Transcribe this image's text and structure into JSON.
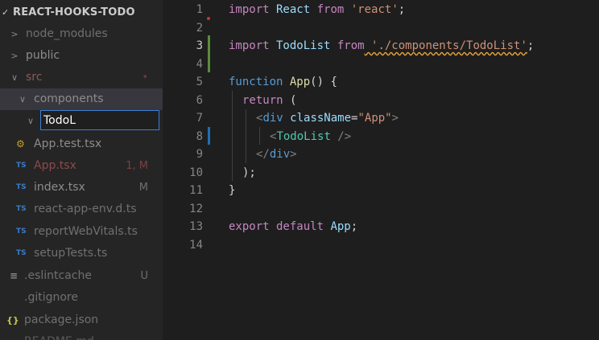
{
  "sidebar": {
    "header": "REACT-HOOKS-TODO",
    "items": [
      {
        "label": "node_modules",
        "status": ""
      },
      {
        "label": "public",
        "status": ""
      },
      {
        "label": "src",
        "status": "•"
      },
      {
        "label": "components",
        "status": ""
      },
      {
        "label": "TodoL",
        "status": ""
      },
      {
        "label": "App.test.tsx",
        "icon": "test-flask-icon",
        "status": ""
      },
      {
        "label": "App.tsx",
        "icon": "TS",
        "status": "1, M"
      },
      {
        "label": "index.tsx",
        "icon": "TS",
        "status": "M"
      },
      {
        "label": "react-app-env.d.ts",
        "icon": "TS",
        "status": ""
      },
      {
        "label": "reportWebVitals.ts",
        "icon": "TS",
        "status": ""
      },
      {
        "label": "setupTests.ts",
        "icon": "TS",
        "status": ""
      },
      {
        "label": ".eslintcache",
        "icon": "≡",
        "status": "U"
      },
      {
        "label": ".gitignore",
        "icon": "",
        "status": ""
      },
      {
        "label": "package.json",
        "icon": "{}",
        "status": ""
      },
      {
        "label": "README.md",
        "icon": "",
        "status": ""
      }
    ],
    "rename_value": "TodoL"
  },
  "editor": {
    "line_numbers": [
      "1",
      "2",
      "3",
      "4",
      "5",
      "6",
      "7",
      "8",
      "9",
      "10",
      "11",
      "12",
      "13",
      "14"
    ],
    "lines": {
      "l1": {
        "a": "import",
        "b": " React ",
        "c": "from",
        "d": " 'react'",
        "e": ";"
      },
      "l3": {
        "a": "import",
        "b": " TodoList ",
        "c": "from",
        "d": " './components/TodoList'",
        "e": ";"
      },
      "l5": {
        "a": "function",
        "b": " App",
        "c": "() {"
      },
      "l6": {
        "a": "return",
        "b": " ("
      },
      "l7": {
        "a": "<",
        "b": "div",
        "c": " className",
        "d": "=",
        "e": "\"App\"",
        "f": ">"
      },
      "l8": {
        "a": "<",
        "b": "TodoList",
        "c": " />"
      },
      "l9": {
        "a": "</",
        "b": "div",
        "c": ">"
      },
      "l10": {
        "a": ");"
      },
      "l11": {
        "a": "}"
      },
      "l13": {
        "a": "export",
        "b": " default",
        "c": " App",
        "d": ";"
      }
    }
  },
  "colors": {
    "keyword": "#c586c0",
    "string": "#ce9178",
    "tag": "#4ec9b0",
    "function": "#dcdcaa",
    "accent": "#3b7fd4"
  }
}
